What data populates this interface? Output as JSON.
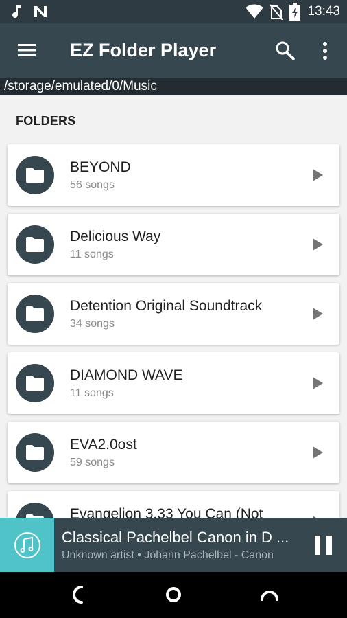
{
  "status_bar": {
    "time": "13:43",
    "icons": [
      "music-note-icon",
      "n-notification-icon",
      "wifi-icon",
      "no-sim-icon",
      "battery-charging-icon"
    ]
  },
  "app_bar": {
    "title": "EZ Folder Player",
    "icons": [
      "menu-icon",
      "search-icon",
      "more-vert-icon"
    ]
  },
  "path": "/storage/emulated/0/Music",
  "section_title": "FOLDERS",
  "folders": [
    {
      "name": "BEYOND",
      "count": "56 songs"
    },
    {
      "name": "Delicious Way",
      "count": "11 songs"
    },
    {
      "name": "Detention Original Soundtrack",
      "count": "34 songs"
    },
    {
      "name": "DIAMOND WAVE",
      "count": "11 songs"
    },
    {
      "name": "EVA2.0ost",
      "count": "59 songs"
    },
    {
      "name": "Evangelion 3.33 You Can (Not",
      "count": ""
    }
  ],
  "now_playing": {
    "title": "Classical Pachelbel Canon in D ...",
    "subtitle": "Unknown artist • Johann Pachelbel - Canon",
    "art_icon": "music-note-icon",
    "control_icon": "pause-icon"
  },
  "nav_bar": {
    "icons": [
      "back-icon",
      "home-icon",
      "recents-icon"
    ]
  },
  "colors": {
    "status_bar": "#2e3b43",
    "app_bar": "#37474f",
    "path_bar": "#232c31",
    "accent": "#4fc3c8",
    "background": "#f2f2f2"
  }
}
